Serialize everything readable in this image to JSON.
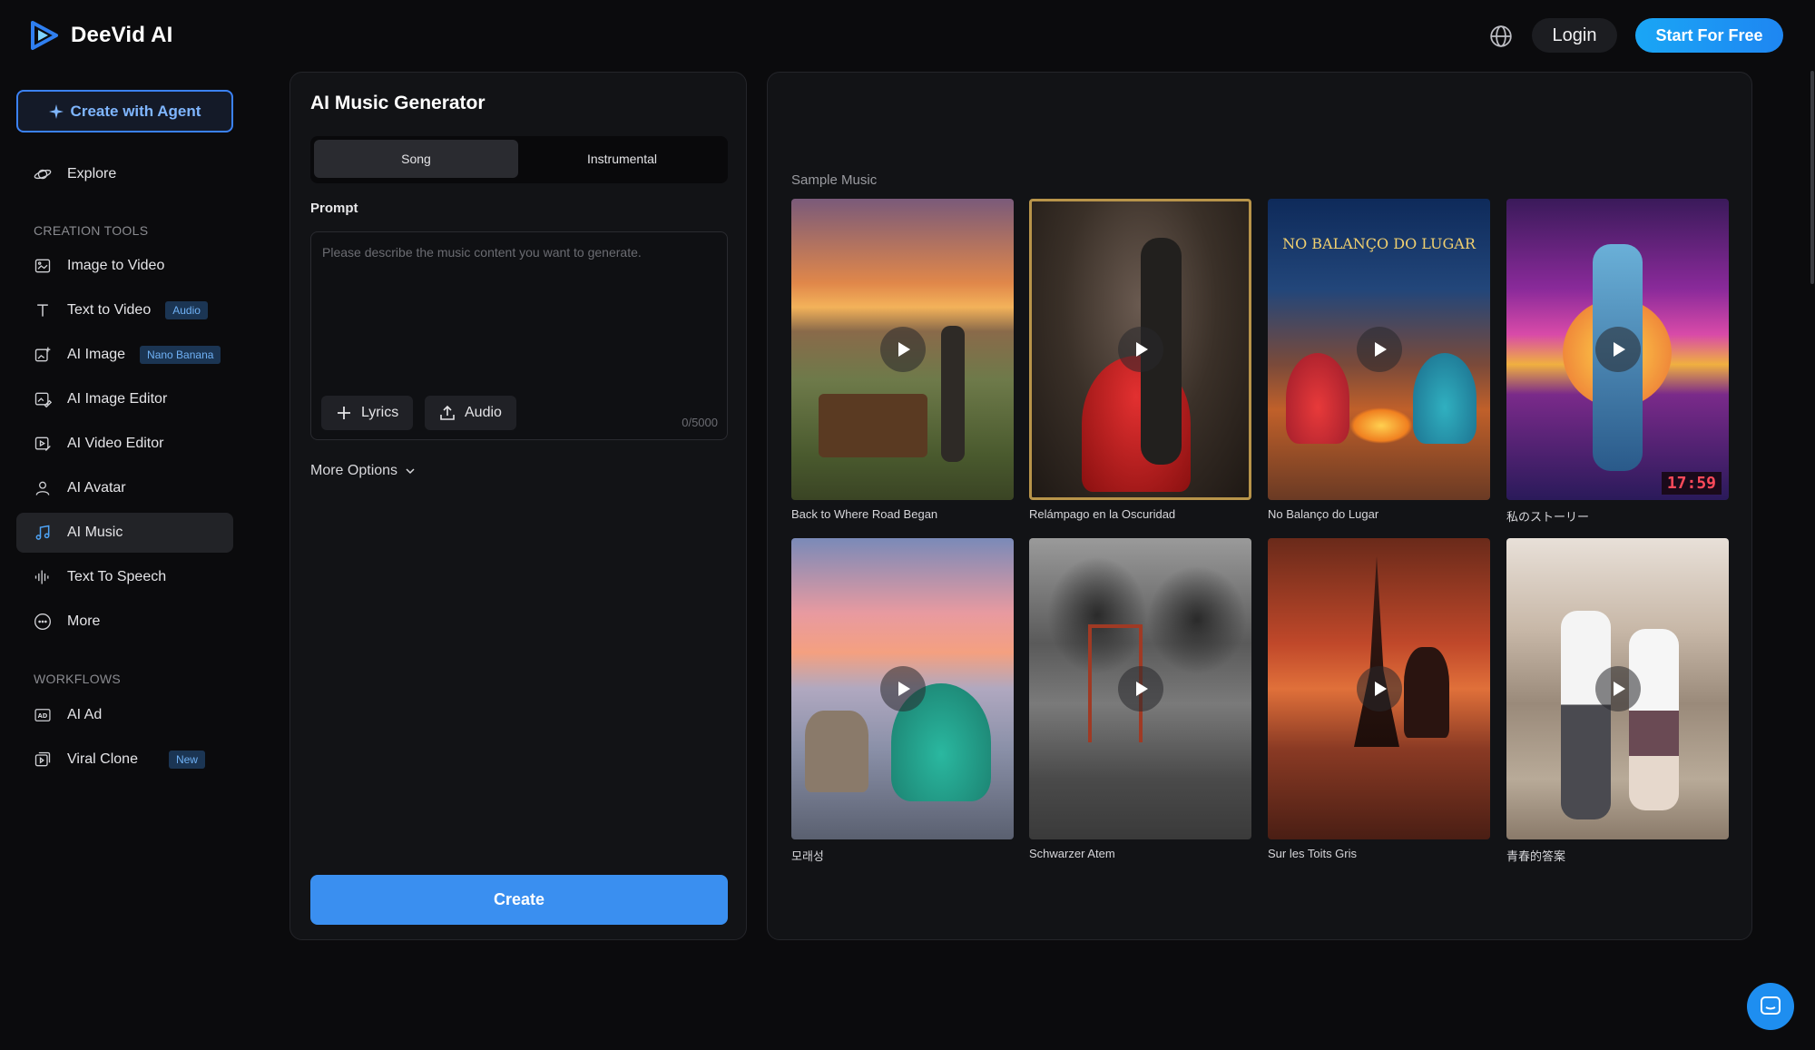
{
  "header": {
    "brand": "DeeVid AI",
    "login": "Login",
    "start": "Start For Free"
  },
  "sidebar": {
    "agent_button": "Create with Agent",
    "explore": "Explore",
    "creation_tools_label": "CREATION TOOLS",
    "items": [
      {
        "label": "Image to Video",
        "badge": ""
      },
      {
        "label": "Text to Video",
        "badge": "Audio"
      },
      {
        "label": "AI Image",
        "badge": "Nano Banana"
      },
      {
        "label": "AI Image Editor",
        "badge": ""
      },
      {
        "label": "AI Video Editor",
        "badge": ""
      },
      {
        "label": "AI Avatar",
        "badge": ""
      },
      {
        "label": "AI Music",
        "badge": ""
      },
      {
        "label": "Text To Speech",
        "badge": ""
      },
      {
        "label": "More",
        "badge": ""
      }
    ],
    "workflows_label": "WORKFLOWS",
    "workflows": [
      {
        "label": "AI Ad",
        "badge": ""
      },
      {
        "label": "Viral Clone",
        "badge": "New"
      }
    ]
  },
  "generator": {
    "title": "AI Music Generator",
    "tabs": [
      "Song",
      "Instrumental"
    ],
    "prompt_label": "Prompt",
    "prompt_placeholder": "Please describe the music content you want to generate.",
    "lyrics_button": "Lyrics",
    "audio_button": "Audio",
    "counter": "0/5000",
    "more_options": "More Options",
    "create": "Create"
  },
  "samples": {
    "label": "Sample Music",
    "items": [
      {
        "title": "Back to Where Road Began"
      },
      {
        "title": "Relámpago en la Oscuridad"
      },
      {
        "title": "No Balanço do Lugar",
        "overlay": "NO BALANÇO DO LUGAR"
      },
      {
        "title": "私のストーリー",
        "overlay": "17:59"
      },
      {
        "title": "모래성"
      },
      {
        "title": "Schwarzer Atem"
      },
      {
        "title": "Sur les Toits Gris"
      },
      {
        "title": "青春的答案"
      }
    ]
  },
  "colors": {
    "accent": "#3a8ff0",
    "badge_bg": "#1b3553",
    "badge_text": "#6fb1f5",
    "panel": "#121316",
    "background": "#0b0b0d"
  }
}
